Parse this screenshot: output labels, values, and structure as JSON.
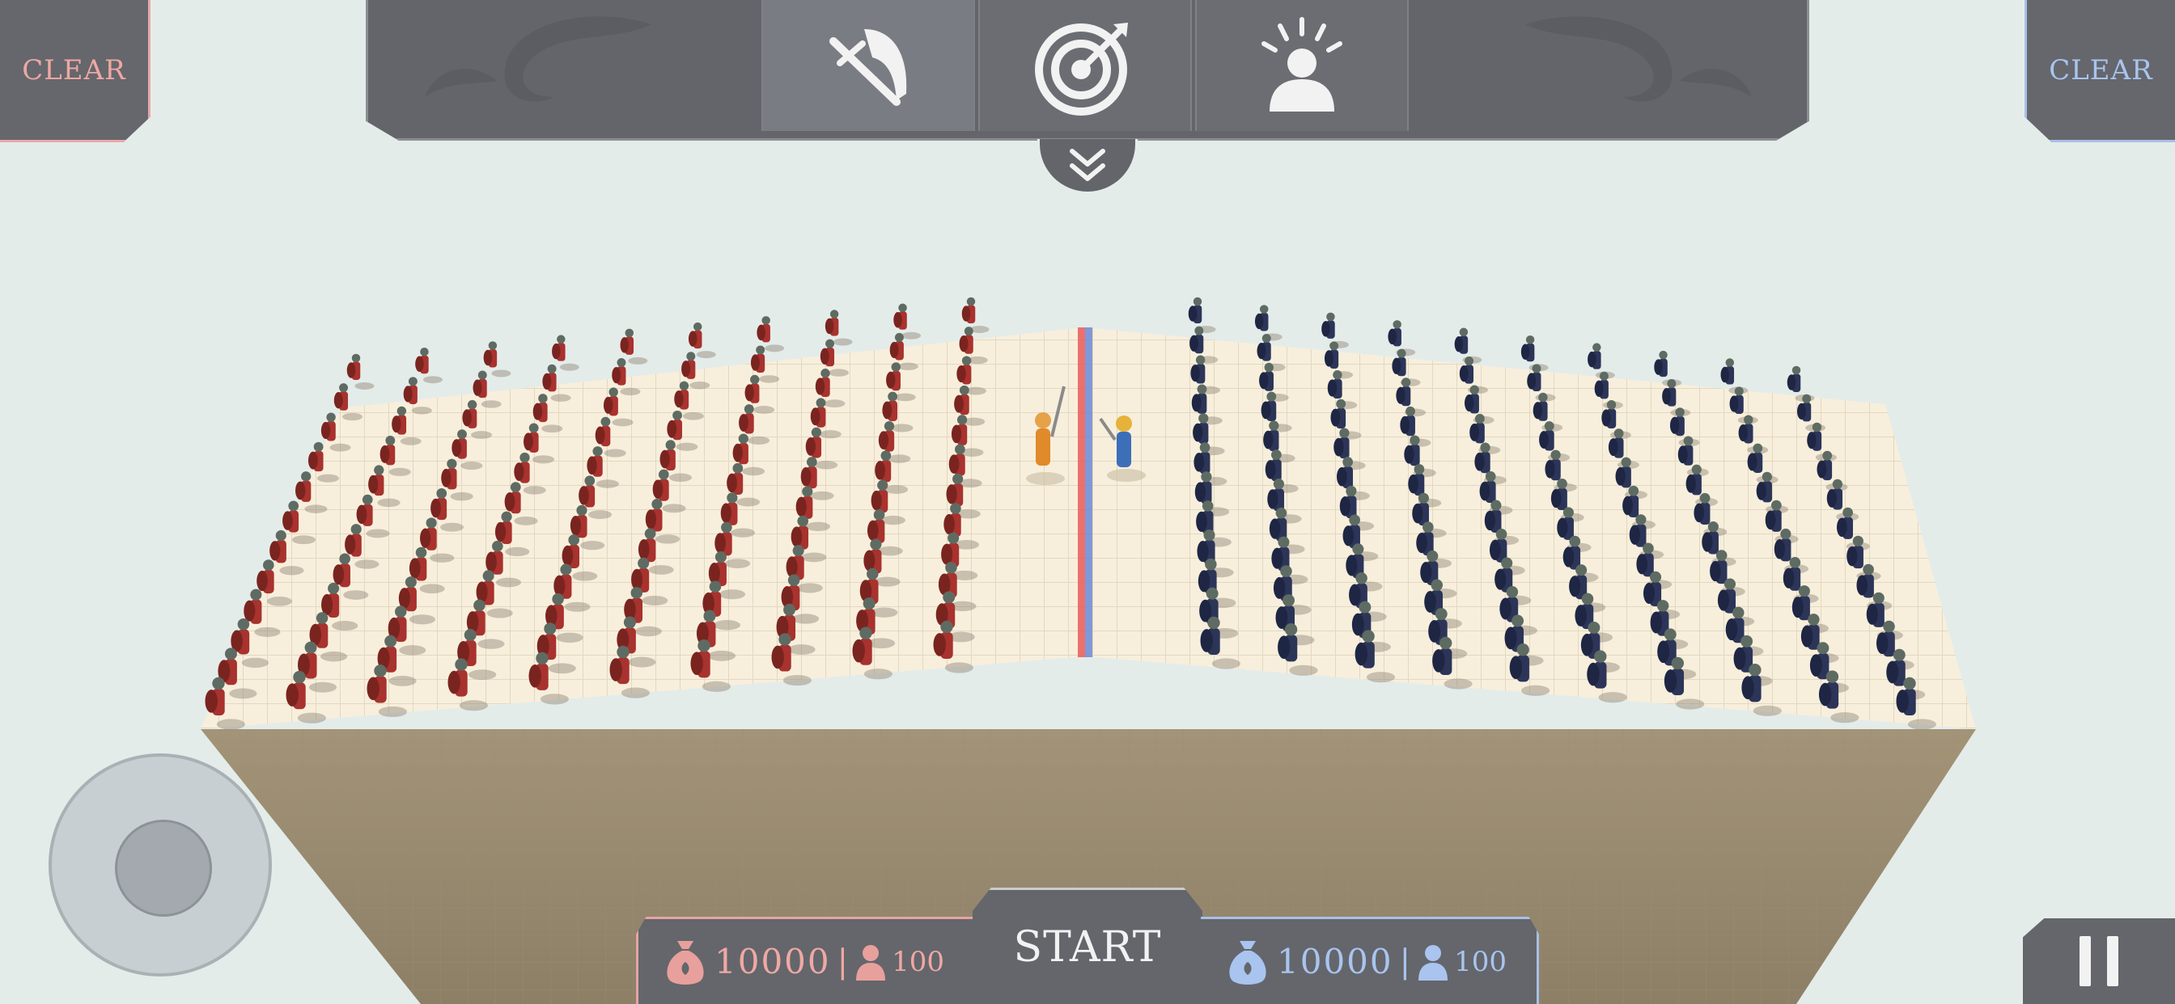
{
  "clear_left": {
    "label": "CLEAR",
    "color": "#f0a7a2"
  },
  "clear_right": {
    "label": "CLEAR",
    "color": "#a9c4ee"
  },
  "category_tabs": [
    {
      "name": "melee-units",
      "icon": "sword-helmet-icon",
      "active": true
    },
    {
      "name": "ranged-units",
      "icon": "target-arrow-icon",
      "active": false
    },
    {
      "name": "special-units",
      "icon": "glowing-person-icon",
      "active": false
    }
  ],
  "collapse_icon": "double-chevron-down-icon",
  "red_team": {
    "gold": "10000",
    "units": "100",
    "color": "#e8a09c",
    "unit_color": "#a8322e"
  },
  "blue_team": {
    "gold": "10000",
    "units": "100",
    "color": "#a9c4ee",
    "unit_color": "#2c3558"
  },
  "start_button": {
    "label": "START"
  },
  "pause_icon": "pause-icon",
  "joystick_icon": "virtual-joystick"
}
